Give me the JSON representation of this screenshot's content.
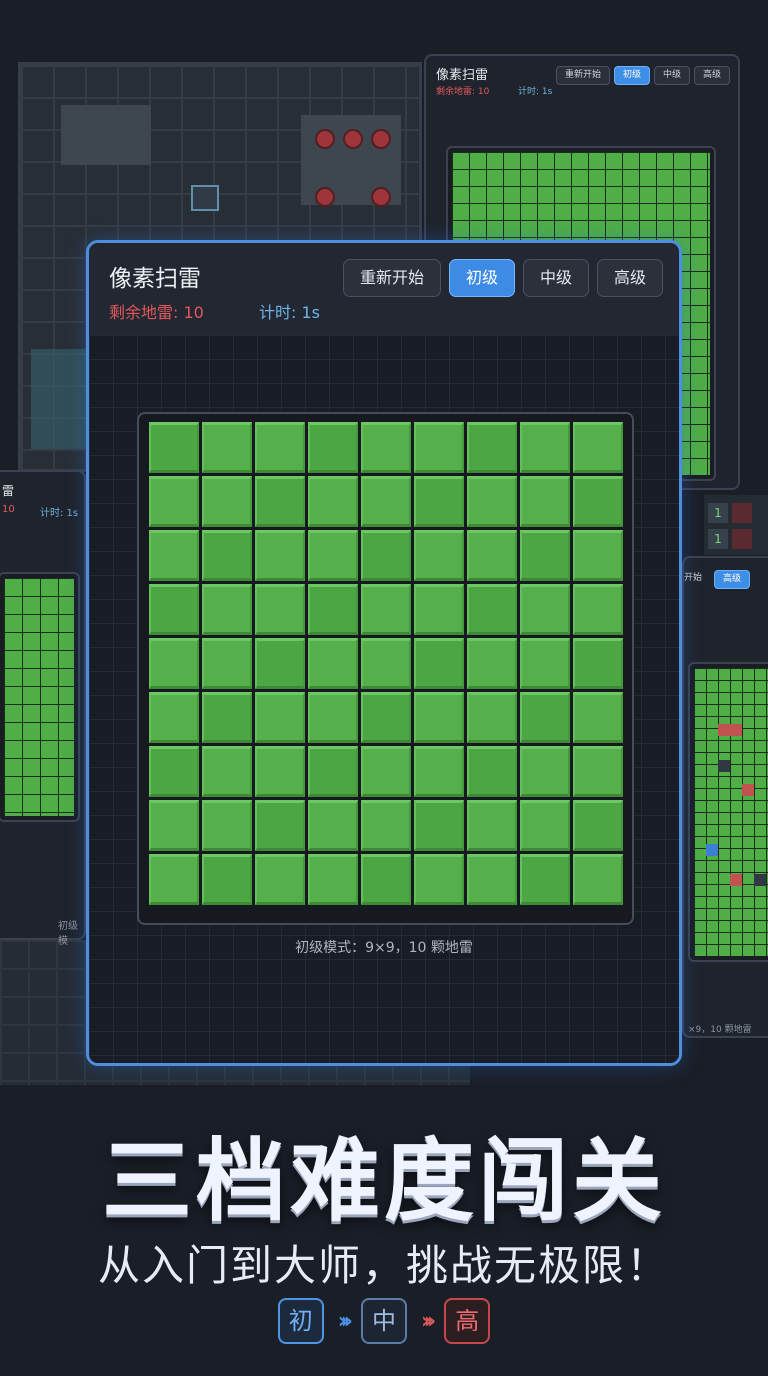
{
  "main": {
    "title": "像素扫雷",
    "mines_label": "剩余地雷: 10",
    "time_label": "计时: 1s",
    "buttons": {
      "restart": "重新开始",
      "beginner": "初级",
      "intermediate": "中级",
      "expert": "高级"
    },
    "active_difficulty": "beginner",
    "footer": "初级模式：9×9，10 颗地雷",
    "rows": 9,
    "cols": 9
  },
  "preview_top_right": {
    "title": "像素扫雷",
    "mines_label": "剩余地雷: 10",
    "time_label": "计时: 1s",
    "buttons": {
      "restart": "重新开始",
      "beginner": "初级",
      "intermediate": "中级",
      "expert": "高级"
    }
  },
  "preview_left": {
    "title": "雷",
    "mines_label": "10",
    "time_label": "计时: 1s",
    "footer": "初级模"
  },
  "preview_right": {
    "buttons": {
      "restart": "开始",
      "expert": "高级"
    },
    "footer": "×9，10 颗地雷"
  },
  "promo": {
    "title": "三档难度闯关",
    "subtitle": "从入门到大师，挑战无极限！",
    "levels": {
      "beginner": "初",
      "intermediate": "中",
      "expert": "高"
    }
  },
  "colors": {
    "accent": "#3d8be4",
    "tile": "#55b04b",
    "mines_text": "#e0585c",
    "time_text": "#6db4e8",
    "expert": "#d8575c"
  }
}
